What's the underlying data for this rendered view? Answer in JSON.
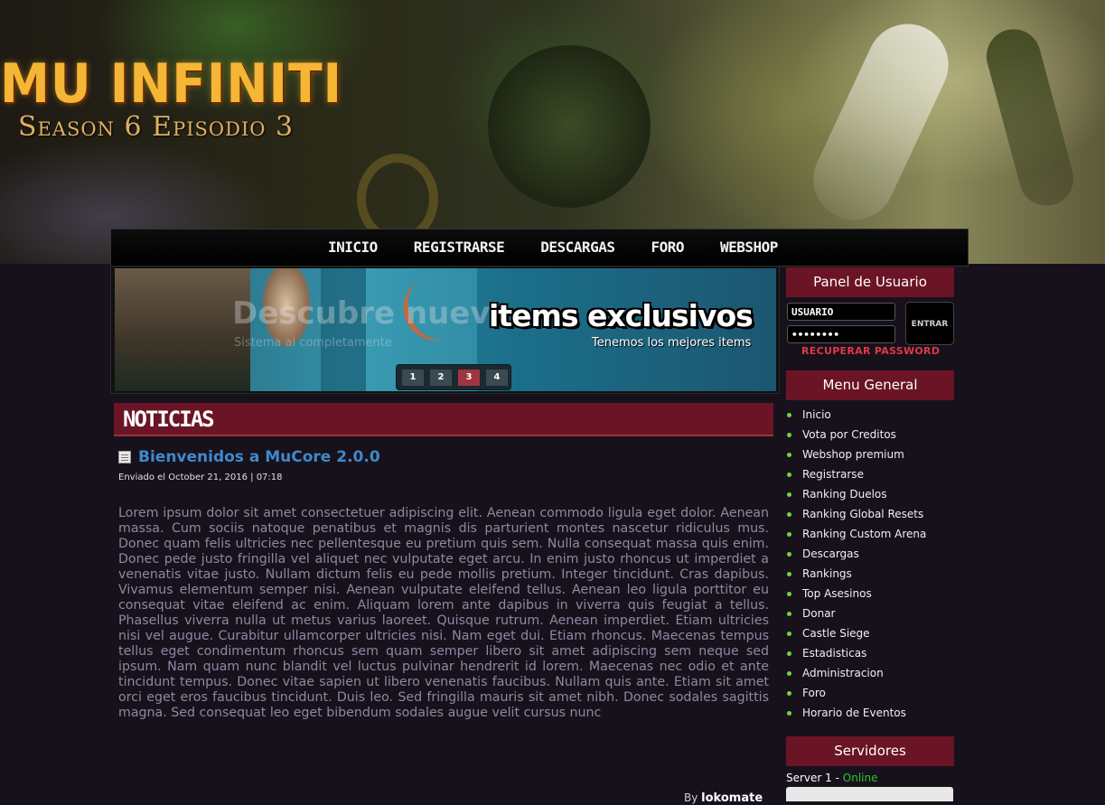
{
  "header": {
    "logo_title": "MU INFINITI",
    "logo_subtitle": "Season 6 Episodio 3"
  },
  "nav": {
    "items": [
      "Inicio",
      "Registrarse",
      "Descargas",
      "Foro",
      "Webshop"
    ]
  },
  "slider": {
    "ghost_title": "Descubre nuev",
    "ghost_subtitle": "Sistema al completamente",
    "title": "items exclusivos",
    "subtitle": "Tenemos los mejores items",
    "pages": [
      "1",
      "2",
      "3",
      "4"
    ],
    "active_page": 3
  },
  "news": {
    "section_title": "NOTICIAS",
    "post": {
      "title": "Bienvenidos a MuCore 2.0.0",
      "meta": "Enviado el October 21, 2016 | 07:18",
      "body": "Lorem ipsum dolor sit amet consectetuer adipiscing elit. Aenean commodo ligula eget dolor. Aenean massa. Cum sociis natoque penatibus et magnis dis parturient montes nascetur ridiculus mus. Donec quam felis ultricies nec pellentesque eu pretium quis sem. Nulla consequat massa quis enim. Donec pede justo fringilla vel aliquet nec vulputate eget arcu. In enim justo rhoncus ut imperdiet a venenatis vitae justo. Nullam dictum felis eu pede mollis pretium. Integer tincidunt. Cras dapibus. Vivamus elementum semper nisi. Aenean vulputate eleifend tellus. Aenean leo ligula porttitor eu consequat vitae eleifend ac enim. Aliquam lorem ante dapibus in viverra quis feugiat a tellus. Phasellus viverra nulla ut metus varius laoreet. Quisque rutrum. Aenean imperdiet. Etiam ultricies nisi vel augue. Curabitur ullamcorper ultricies nisi. Nam eget dui. Etiam rhoncus. Maecenas tempus tellus eget condimentum rhoncus sem quam semper libero sit amet adipiscing sem neque sed ipsum. Nam quam nunc blandit vel luctus pulvinar hendrerit id lorem. Maecenas nec odio et ante tincidunt tempus. Donec vitae sapien ut libero venenatis faucibus. Nullam quis ante. Etiam sit amet orci eget eros faucibus tincidunt. Duis leo. Sed fringilla mauris sit amet nibh. Donec sodales sagittis magna. Sed consequat leo eget bibendum sodales augue velit cursus nunc",
      "by_label": "By",
      "author": "lokomate"
    }
  },
  "sidebar": {
    "panel_title": "Panel de Usuario",
    "username_value": "USUARIO",
    "password_value": "••••••••",
    "login_button": "ENTRAR",
    "recover_link": "RECUPERAR PASSWORD",
    "menu_title": "Menu General",
    "menu_items": [
      "Inicio",
      "Vota por Creditos",
      "Webshop premium",
      "Registrarse",
      "Ranking Duelos",
      "Ranking Global Resets",
      "Ranking Custom Arena",
      "Descargas",
      "Rankings",
      "Top Asesinos",
      "Donar",
      "Castle Siege",
      "Estadisticas",
      "Administracion",
      "Foro",
      "Horario de Eventos"
    ],
    "servers_title": "Servidores",
    "server_name": "Server 1 - ",
    "server_status": "Online"
  },
  "colors": {
    "accent_red": "#6a1425",
    "link_blue": "#3e8acc",
    "online_green": "#2ec52e",
    "bullet_green": "#6fd63c"
  }
}
